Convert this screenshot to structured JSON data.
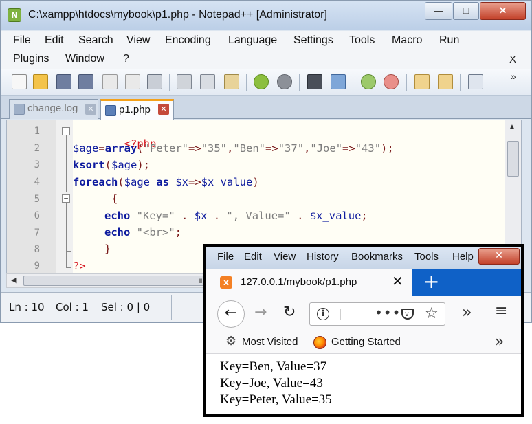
{
  "notepadpp": {
    "title": "C:\\xampp\\htdocs\\mybook\\p1.php - Notepad++ [Administrator]",
    "app_icon": "N",
    "window_buttons": {
      "minimize": "—",
      "maximize": "□",
      "close": "✕"
    },
    "menu": [
      "File",
      "Edit",
      "Search",
      "View",
      "Encoding",
      "Language",
      "Settings",
      "Tools",
      "Macro",
      "Run",
      "Plugins",
      "Window",
      "?"
    ],
    "menu_close": "X",
    "toolbar_overflow": "»",
    "tabs": [
      {
        "label": "change.log",
        "active": false,
        "close": "✕"
      },
      {
        "label": "p1.php",
        "active": true,
        "close": "✕"
      }
    ],
    "line_numbers": [
      "1",
      "2",
      "3",
      "4",
      "5",
      "6",
      "7",
      "8",
      "9"
    ],
    "code": {
      "l1_open": "<?php",
      "l2_var": "$age",
      "l2_eq": "=",
      "l2_func": "array",
      "l2_paren_open": "(",
      "l2_s1": "\"Peter\"",
      "l2_op1": "=>",
      "l2_s2": "\"35\"",
      "l2_c1": ",",
      "l2_s3": "\"Ben\"",
      "l2_op2": "=>",
      "l2_s4": "\"37\"",
      "l2_c2": ",",
      "l2_s5": "\"Joe\"",
      "l2_op3": "=>",
      "l2_s6": "\"43\"",
      "l2_end": ");",
      "l3_func": "ksort",
      "l3_paren": "(",
      "l3_var": "$age",
      "l3_end": ");",
      "l4_kw": "foreach",
      "l4_paren": "(",
      "l4_var": "$age",
      "l4_as": " as ",
      "l4_x": "$x",
      "l4_op": "=>",
      "l4_val": "$x_value",
      "l4_end": ")",
      "l5_brace": "{",
      "l6_echo": "echo",
      "l6_s1": "\"Key=\"",
      "l6_dot1": ".",
      "l6_x": "$x",
      "l6_dot2": ".",
      "l6_s2": "\", Value=\"",
      "l6_dot3": ".",
      "l6_val": "$x_value",
      "l6_end": ";",
      "l7_echo": "echo",
      "l7_s": "\"<br>\"",
      "l7_end": ";",
      "l8_brace": "}",
      "l9_close": "?>"
    },
    "fold_markers": {
      "open": "−"
    },
    "scroll": {
      "up": "▲",
      "left": "◀",
      "grip": "III"
    },
    "status": {
      "ln": "Ln : 10",
      "col": "Col : 1",
      "sel": "Sel : 0 | 0"
    }
  },
  "firefox": {
    "menu": [
      "File",
      "Edit",
      "View",
      "History",
      "Bookmarks",
      "Tools",
      "Help"
    ],
    "close": "✕",
    "tab": {
      "title": "127.0.0.1/mybook/p1.php",
      "icon": "x",
      "close": "✕"
    },
    "new_tab": "+",
    "nav": {
      "back": "←",
      "forward": "→",
      "reload": "↻",
      "info": "i",
      "more": "•••",
      "star": "☆",
      "overflow": "»",
      "menu": "≡"
    },
    "bookmarks": {
      "gear": "⚙",
      "most_visited": "Most Visited",
      "getting_started": "Getting Started",
      "more": "»"
    },
    "output": [
      "Key=Ben, Value=37",
      "Key=Joe, Value=43",
      "Key=Peter, Value=35"
    ]
  },
  "colors": {
    "php_tag": "#d6141e",
    "variable": "#0e1b9e",
    "string": "#7d7d7d",
    "operator": "#7a1a1a",
    "active_tab_accent": "#f4a11a",
    "firefox_tabstrip": "#0f61c7"
  },
  "icons": {
    "toolbar": [
      "new-file-icon",
      "open-file-icon",
      "save-icon",
      "save-all-icon",
      "close-icon",
      "close-all-icon",
      "print-icon",
      "cut-icon",
      "copy-icon",
      "paste-icon",
      "undo-icon",
      "redo-icon",
      "find-icon",
      "replace-icon",
      "zoom-in-icon",
      "zoom-out-icon",
      "sync-v-icon",
      "sync-h-icon",
      "word-wrap-icon"
    ]
  }
}
